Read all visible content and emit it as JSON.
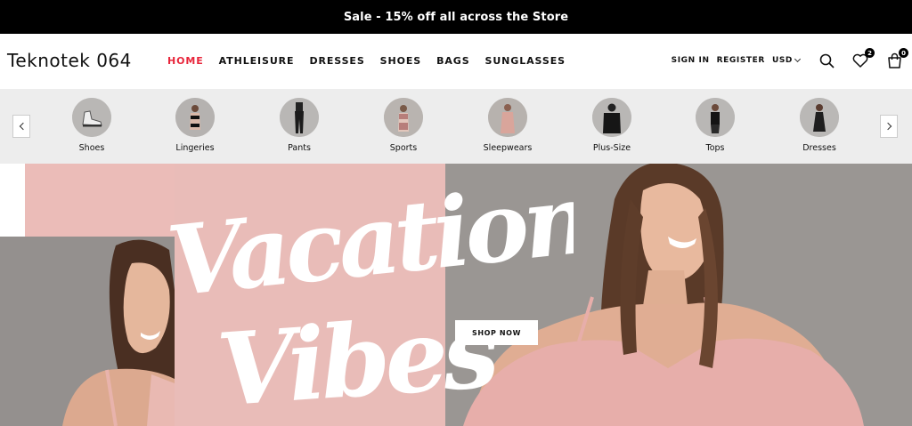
{
  "announcement": {
    "text": "Sale - 15% off all across the Store"
  },
  "header": {
    "logo": "Teknotek 064",
    "nav": [
      {
        "label": "HOME",
        "active": true
      },
      {
        "label": "ATHLEISURE"
      },
      {
        "label": "DRESSES"
      },
      {
        "label": "SHOES"
      },
      {
        "label": "BAGS"
      },
      {
        "label": "SUNGLASSES"
      }
    ],
    "sign_in": "SIGN IN",
    "register": "REGISTER",
    "currency": "USD",
    "wishlist_count": "2",
    "cart_count": "0",
    "accent_color": "#e8263b"
  },
  "categories": {
    "items": [
      {
        "label": "Shoes"
      },
      {
        "label": "Lingeries"
      },
      {
        "label": "Pants"
      },
      {
        "label": "Sports"
      },
      {
        "label": "Sleepwears"
      },
      {
        "label": "Plus-Size"
      },
      {
        "label": "Tops"
      },
      {
        "label": "Dresses"
      }
    ]
  },
  "hero": {
    "headline_line1": "Vacation",
    "headline_line2": "Vibes",
    "cta": "SHOP NOW",
    "pink_color": "#e9bcb8"
  }
}
